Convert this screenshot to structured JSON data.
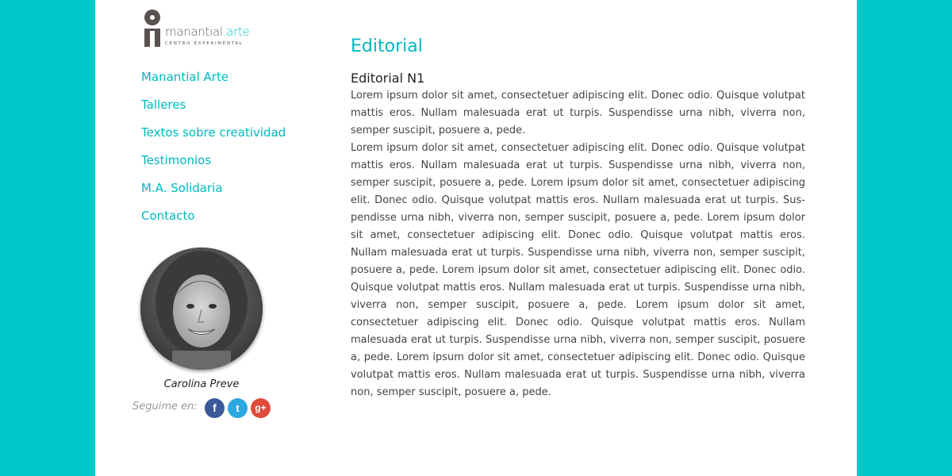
{
  "logo": {
    "name_part1": "manantial",
    "name_part2": ".arte",
    "tagline": "CENTRO EXPERIMENTAL"
  },
  "nav": {
    "items": [
      {
        "label": "Manantial Arte"
      },
      {
        "label": "Talleres"
      },
      {
        "label": "Textos sobre creatividad"
      },
      {
        "label": "Testimonios"
      },
      {
        "label": "M.A. Solidaria"
      },
      {
        "label": "Contacto"
      }
    ]
  },
  "profile": {
    "name": "Carolina Preve",
    "follow_label": "Seguime en:",
    "social": [
      {
        "icon": "facebook-icon",
        "glyph": "f"
      },
      {
        "icon": "twitter-icon",
        "glyph": "t"
      },
      {
        "icon": "google-plus-icon",
        "glyph": "g+"
      }
    ]
  },
  "main": {
    "title": "Editorial",
    "subtitle": "Editorial N1",
    "paragraphs": [
      "Lorem ipsum dolor sit amet, consectetuer adipiscing elit. Donec odio. Quisque volutpat mattis eros. Nullam malesuada erat ut turpis. Suspendisse urna nibh, viverra non, semper suscipit, posuere a, pede.",
      "Lorem ipsum dolor sit amet, consectetuer adipiscing elit. Donec odio. Quisque volutpat mattis eros. Nullam malesuada erat ut turpis. Suspendisse urna nibh, viverra non, semper suscipit, posuere a, pede. Lorem ipsum dolor sit amet, consectetuer adipiscing elit. Donec odio. Quisque volutpat mattis eros. Nullam malesuada erat ut turpis. Sus­pendisse urna nibh, viverra non, semper suscipit, posuere a, pede. Lorem ipsum dolor sit amet, consectetuer adipiscing elit. Donec odio. Quisque volutpat mattis eros. Nullam malesuada erat ut turpis. Suspendisse urna nibh, viverra non, semper suscipit, posuere a, pede. Lorem ipsum dolor sit amet, consectetuer adipiscing elit. Donec odio. Quisque volutpat mattis eros. Nullam malesuada erat ut turpis. Suspendisse urna nibh, viverra non, semper suscipit, posuere a, pede. Lorem ipsum dolor sit amet, consectetuer adipi­scing elit. Donec odio. Quisque volutpat mattis eros. Nullam malesuada erat ut turpis. Suspendisse urna nibh, viverra non, semper suscipit, posuere a, pede. Lorem ipsum dolor sit amet, consectetuer adipiscing elit. Donec odio. Quisque volutpat mattis eros. Nullam malesuada erat ut turpis. Suspendisse urna nibh, viverra non, semper suscipit, posuere a, pede."
    ]
  },
  "colors": {
    "background": "#00c8c8",
    "accent": "#00b8c0",
    "page": "#ffffff"
  }
}
